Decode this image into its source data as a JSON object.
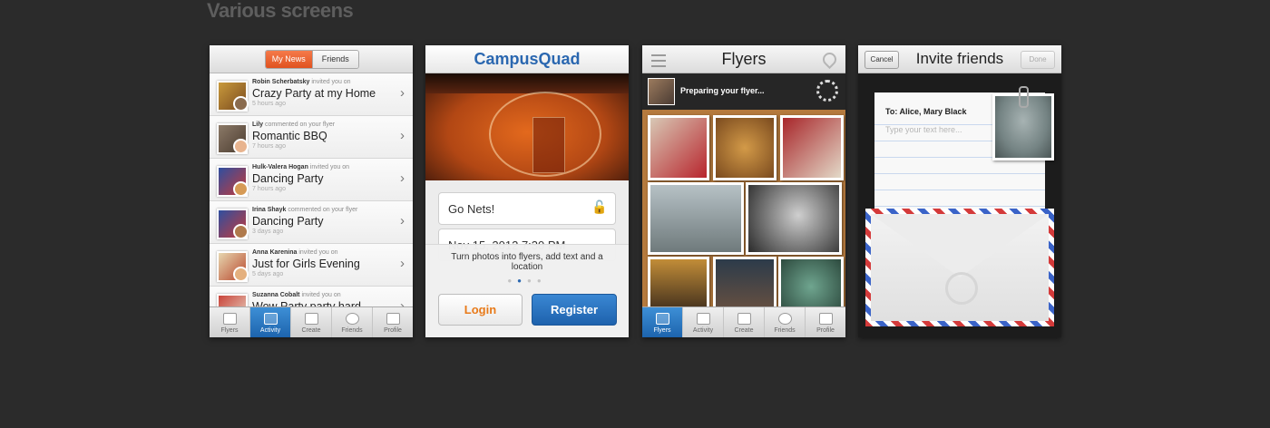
{
  "heading": "Various screens",
  "news": {
    "segments": [
      "My News",
      "Friends"
    ],
    "items": [
      {
        "actor": "Robin Scherbatsky",
        "action": "invited you on",
        "title": "Crazy Party at my Home",
        "time": "5 hours ago"
      },
      {
        "actor": "Lily",
        "action": "commented on your flyer",
        "title": "Romantic BBQ",
        "time": "7 hours ago"
      },
      {
        "actor": "Hulk-Valera Hogan",
        "action": "invited you on",
        "title": "Dancing Party",
        "time": "7 hours ago"
      },
      {
        "actor": "Irina Shayk",
        "action": "commented on your flyer",
        "title": "Dancing Party",
        "time": "3 days ago"
      },
      {
        "actor": "Anna Karenina",
        "action": "invited you on",
        "title": "Just for Girls Evening",
        "time": "5 days ago"
      },
      {
        "actor": "Suzanna Cobalt",
        "action": "invited you on",
        "title": "Wow Party party hard",
        "time": ""
      }
    ],
    "tabs": [
      "Flyers",
      "Activity",
      "Create",
      "Friends",
      "Profile"
    ],
    "active_tab": "Activity"
  },
  "welcome": {
    "logo": "CampusQuad",
    "field1": "Go Nets!",
    "field2": "Nov 15, 2012 7:30 PM",
    "caption": "Turn photos into flyers, add text and a location",
    "login": "Login",
    "register": "Register"
  },
  "flyers": {
    "title": "Flyers",
    "status": "Preparing your flyer...",
    "tabs": [
      "Flyers",
      "Activity",
      "Create",
      "Friends",
      "Profile"
    ],
    "active_tab": "Flyers"
  },
  "invite": {
    "title": "Invite friends",
    "cancel": "Cancel",
    "done": "Done",
    "to": "To: Alice, Mary Black",
    "placeholder": "Type your text here..."
  },
  "colors": {
    "accent_orange": "#e0521f",
    "accent_blue": "#1e62ad",
    "background": "#2b2b2b"
  }
}
